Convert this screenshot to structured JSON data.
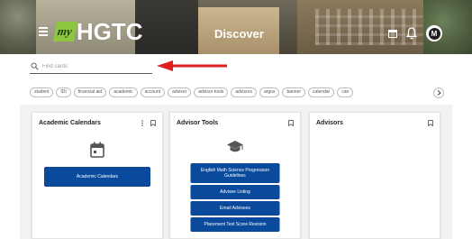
{
  "header": {
    "logo_my": "my",
    "logo_text": "HGTC",
    "page_title": "Discover",
    "avatar_initial": "M"
  },
  "search": {
    "placeholder": "Find cards"
  },
  "chips": [
    "student",
    "IDI",
    "financial aid",
    "academic",
    "account",
    "advisor",
    "advisor tools",
    "advisors",
    "argos",
    "banner",
    "calendar",
    "can"
  ],
  "cards": {
    "academic_calendars": {
      "title": "Academic Calendars",
      "button": "Academic Calendars"
    },
    "advisor_tools": {
      "title": "Advisor Tools",
      "buttons": [
        "English Math Science Progression Guidelines",
        "Advisee Listing",
        "Email Advisees",
        "Placement Test Score Revision"
      ]
    },
    "advisors": {
      "title": "Advisors"
    }
  },
  "colors": {
    "accent_blue": "#0a4a9c",
    "logo_green": "#8dc63f",
    "annotation_red": "#e02020"
  },
  "icons": {
    "menu": "hamburger-icon",
    "window": "window-icon",
    "notifications": "bell-icon",
    "search": "search-icon",
    "card_more": "kebab-icon",
    "card_bookmark": "bookmark-icon",
    "calendar": "calendar-icon",
    "graduation": "graduation-cap-icon",
    "chips_next": "chevron-right-icon"
  }
}
